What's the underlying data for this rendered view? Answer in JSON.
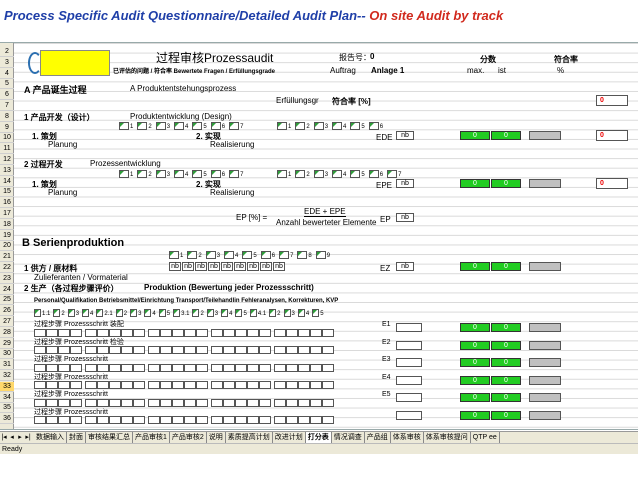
{
  "title": {
    "main": "Process Specific Audit Questionnaire/Detailed Audit Plan--",
    "accent": "On site Audit by track"
  },
  "header": {
    "doc_title": "过程审核Prozessaudit",
    "report_no_label": "报告号：",
    "report_no_value": "0",
    "sub_text": "已评估的问题 / 符合率 Bewertete Fragen / Erfüllungsgrade",
    "auftrag": "Auftrag",
    "anlage": "Anlage 1",
    "score_label": "分数",
    "rate_label": "符合率",
    "max": "max.",
    "ist": "ist",
    "pct": "%"
  },
  "rows": {
    "r4_cn": "A 产品诞生过程",
    "r4_de": "A Produktentstehungsprozess",
    "r5_label": "Erfüllungsgr",
    "r5_rate": "符合率 [%]",
    "r5_value": "0",
    "r6_cn": "1 产品开发（设计）",
    "r6_de": "Produktentwicklung (Design)",
    "r8_plan_cn": "1. 策划",
    "r8_plan_de": "Planung",
    "r8_real_cn": "2. 实现",
    "r8_real_de": "Realisierung",
    "r8_edn": "EDE",
    "r10_cn": "2 过程开发",
    "r10_de": "Prozessentwicklung",
    "r12_plan_cn": "1. 策划",
    "r12_plan_de": "Planung",
    "r12_real_cn": "2. 实现",
    "r12_real_de": "Realisierung",
    "r12_epe": "EPE",
    "r15_formula": "EP [%] =",
    "r15_num": "EDE + EPE",
    "r15_den": "Anzahl bewerteter Elemente",
    "r15_ep": "EP",
    "r18_cn": "B Serienproduktion",
    "r20_cn": "1 供方 / 原材料",
    "r20_de": "Zulieferanten / Vormaterial",
    "r20_ez": "EZ",
    "r22_cn": "2 生产（各过程步骤评价）",
    "r22_de": "Produktion (Bewertung jeder Prozessschritt)",
    "r24_cols": "Personal/Qualifikation  Betriebsmittel/Einrichtung  Transport/Teilehandlin  Fehleranalysen, Korrekturen, KVP",
    "step_label": "过程步骤 Prozessschritt",
    "step_1_name": "装配",
    "step_2_name": "检验",
    "e1": "E1",
    "e2": "E2",
    "e3": "E3",
    "e4": "E4",
    "e5": "E5",
    "nb": "nb",
    "zero": "0",
    "ad_checks": [
      "1",
      "2",
      "3",
      "4",
      "5",
      "6",
      "7"
    ],
    "b_checks": [
      "1",
      "2",
      "3",
      "4",
      "5",
      "6",
      "7",
      "8",
      "9"
    ],
    "g_checks": [
      "1.1",
      "2",
      "3",
      "4",
      "2.1",
      "2",
      "3",
      "4",
      "5",
      "3.1",
      "2",
      "3",
      "4",
      "5",
      "4.1",
      "2",
      "3",
      "4",
      "5"
    ]
  },
  "row_numbers": [
    "2",
    "3",
    "4",
    "5",
    "6",
    "7",
    "8",
    "9",
    "10",
    "11",
    "12",
    "13",
    "14",
    "15",
    "16",
    "17",
    "18",
    "19",
    "20",
    "21",
    "22",
    "23",
    "24",
    "25",
    "26",
    "27",
    "28",
    "29",
    "30",
    "31",
    "32",
    "33",
    "34",
    "35",
    "36"
  ],
  "tabs": [
    "数据输入",
    "封面",
    "审核结果汇总",
    "产品审核1",
    "产品审核2",
    "说明",
    "素质提高计划",
    "改进计划",
    "打分表",
    "情况调查",
    "产品组",
    "体系审核",
    "体系审核提问",
    "QTP ee"
  ],
  "active_tab": "打分表",
  "status": "Ready",
  "colors": {
    "accent_blue": "#1f3fa8",
    "accent_red": "#d12a1e",
    "green": "#22cc22",
    "yellow": "#ffff00"
  }
}
